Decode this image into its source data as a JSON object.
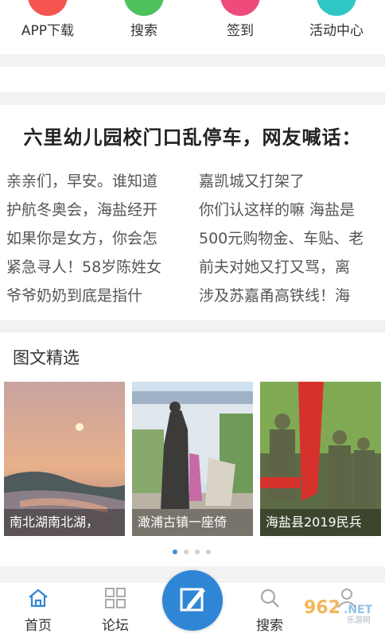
{
  "quick_links": [
    {
      "label": "APP下载",
      "icon": "download-icon",
      "color": "#f4554e"
    },
    {
      "label": "搜索",
      "icon": "search-check-icon",
      "color": "#4fc25e"
    },
    {
      "label": "签到",
      "icon": "checkin-icon",
      "color": "#ef4b7a"
    },
    {
      "label": "活动中心",
      "icon": "activity-icon",
      "color": "#2fc7c4"
    }
  ],
  "headline": "六里幼儿园校门口乱停车，网友喊话：",
  "news_left": [
    "亲亲们，早安。谁知道",
    "护航冬奥会，海盐经开",
    "如果你是女方，你会怎",
    "紧急寻人！58岁陈姓女",
    "爷爷奶奶到底是指什"
  ],
  "news_right": [
    "嘉凯城又打架了",
    "你们认这样的嘛 海盐是",
    "500元购物金、车贴、老",
    "前夫对她又打又骂，离",
    "涉及苏嘉甬高铁线！海"
  ],
  "featured": {
    "title": "图文精选",
    "cards": [
      {
        "caption": "南北湖南北湖，"
      },
      {
        "caption": "澉浦古镇一座倚"
      },
      {
        "caption": "海盐县2019民兵"
      }
    ],
    "active_dot": 0
  },
  "tabbar": {
    "items": [
      {
        "label": "首页",
        "icon": "home-icon"
      },
      {
        "label": "论坛",
        "icon": "grid-icon"
      },
      {
        "label": "",
        "icon": "compose-icon"
      },
      {
        "label": "搜索",
        "icon": "search-icon"
      },
      {
        "label": "",
        "icon": "user-icon"
      }
    ]
  },
  "watermark": {
    "text": "962.NET",
    "sub": "乐游网"
  },
  "colors": {
    "accent": "#2f86d6",
    "gap": "#f2f2f2"
  }
}
